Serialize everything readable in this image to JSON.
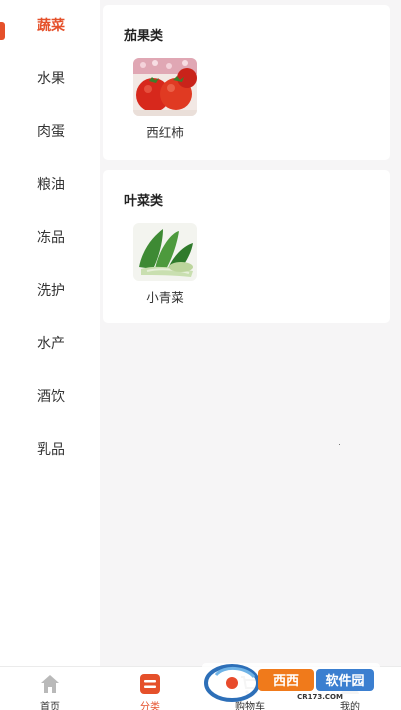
{
  "sidebar": {
    "items": [
      {
        "label": "蔬菜",
        "active": true
      },
      {
        "label": "水果"
      },
      {
        "label": "肉蛋"
      },
      {
        "label": "粮油"
      },
      {
        "label": "冻品"
      },
      {
        "label": "洗护"
      },
      {
        "label": "水产"
      },
      {
        "label": "酒饮"
      },
      {
        "label": "乳品"
      }
    ]
  },
  "categories": [
    {
      "title": "茄果类",
      "products": [
        {
          "name": "西红柿",
          "icon": "tomato-image"
        }
      ]
    },
    {
      "title": "叶菜类",
      "products": [
        {
          "name": "小青菜",
          "icon": "bok-choy-image"
        }
      ]
    }
  ],
  "tabbar": {
    "tabs": [
      {
        "label": "首页",
        "icon": "home-icon"
      },
      {
        "label": "分类",
        "icon": "category-icon",
        "active": true
      },
      {
        "label": "购物车",
        "icon": "cart-icon"
      },
      {
        "label": "我的",
        "icon": "user-icon"
      }
    ]
  },
  "watermark": {
    "text": "西西软件园",
    "domain": "CR173.COM"
  },
  "colors": {
    "accent": "#e5502a",
    "background": "#f6f5f6"
  }
}
